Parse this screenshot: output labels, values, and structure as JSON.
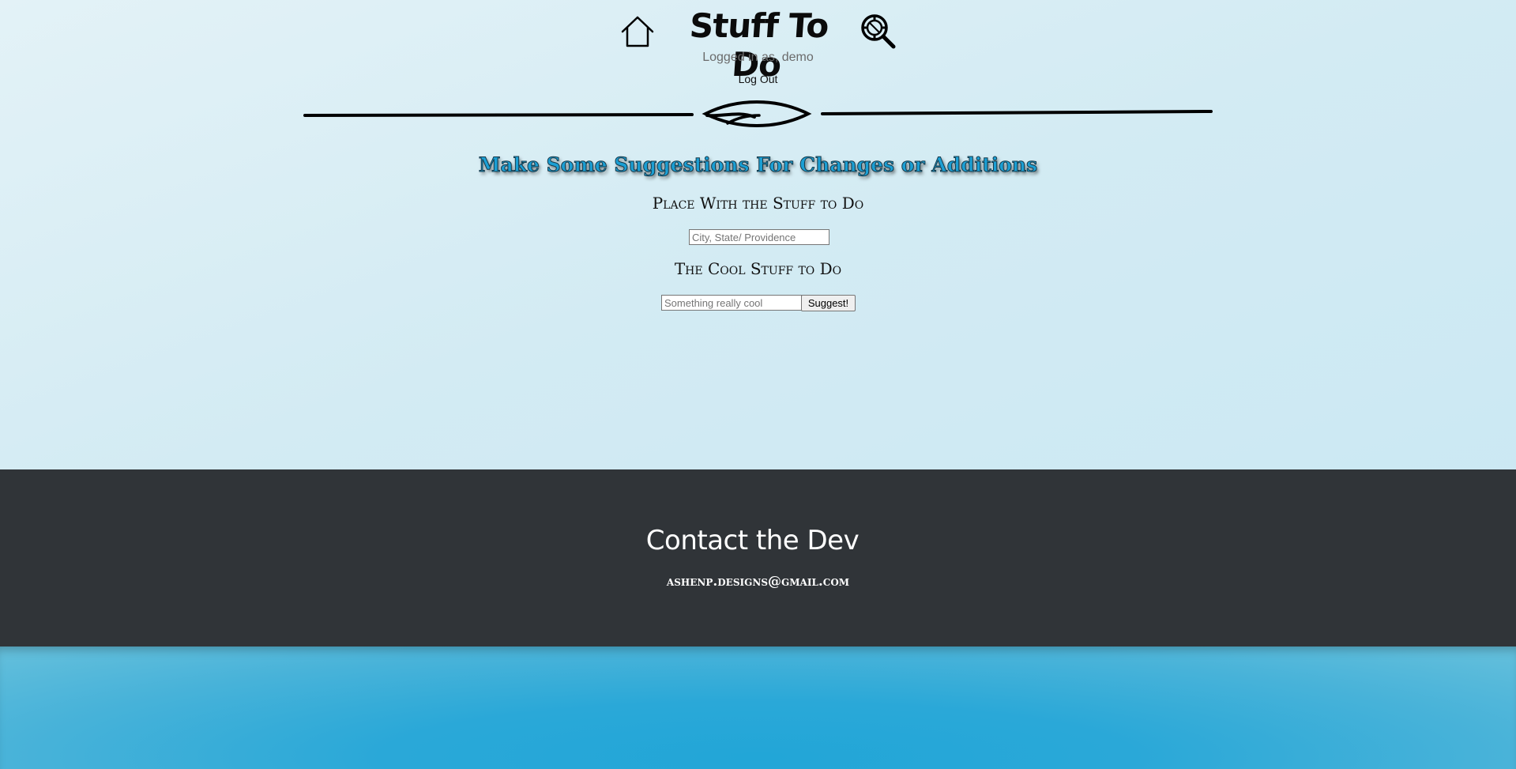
{
  "header": {
    "title": "Stuff To Do",
    "logged_in_text": "Logged in as, demo",
    "logout_label": "Log Out",
    "home_icon": "home-icon",
    "search_icon": "search-icon"
  },
  "main": {
    "heading": "Make Some Suggestions For Changes or Additions",
    "place_label": "Place With the Stuff to Do",
    "place_placeholder": "City, State/ Providence",
    "place_value": "",
    "stuff_label": "The Cool Stuff to Do",
    "stuff_placeholder": "Something really cool",
    "stuff_value": "",
    "submit_label": "Suggest!"
  },
  "footer": {
    "title": "Contact the Dev",
    "email": "ashenp.designs@gmail.com"
  },
  "colors": {
    "heading_fill": "#1b9fd4",
    "footer_bg": "#303438",
    "bottom_band": "#22a6d7"
  }
}
